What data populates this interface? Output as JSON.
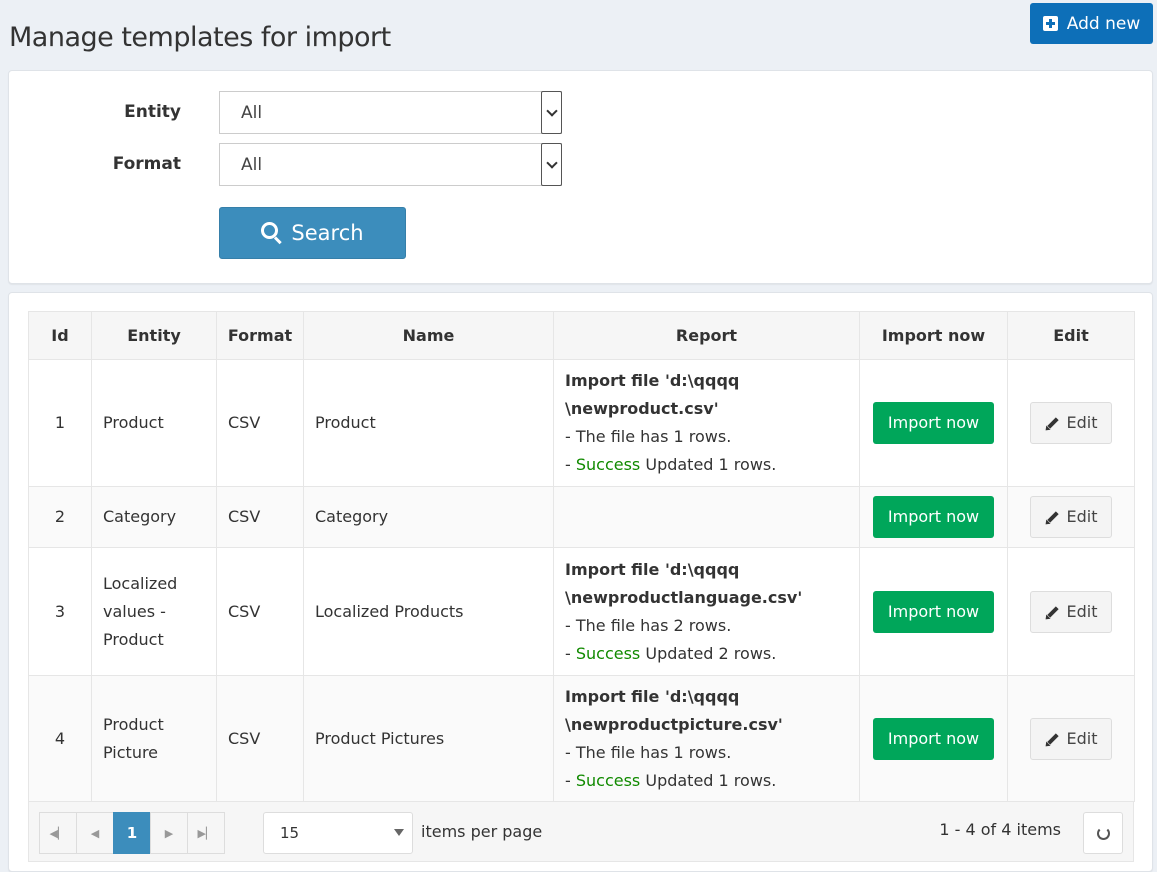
{
  "header": {
    "title": "Manage templates for import",
    "add_new_label": "Add new"
  },
  "filters": {
    "entity_label": "Entity",
    "entity_value": "All",
    "format_label": "Format",
    "format_value": "All",
    "search_label": "Search"
  },
  "table": {
    "columns": [
      "Id",
      "Entity",
      "Format",
      "Name",
      "Report",
      "Import now",
      "Edit"
    ],
    "rows": [
      {
        "id": "1",
        "entity": "Product",
        "format": "CSV",
        "name": "Product",
        "report": {
          "line1": "Import file 'd:\\qqqq",
          "line2": "\\newproduct.csv'",
          "line3": "- The file has 1 rows.",
          "prefix": "- ",
          "success": "Success",
          "suffix": " Updated 1 rows."
        },
        "import_label": "Import now",
        "edit_label": "Edit"
      },
      {
        "id": "2",
        "entity": "Category",
        "format": "CSV",
        "name": "Category",
        "report": null,
        "import_label": "Import now",
        "edit_label": "Edit"
      },
      {
        "id": "3",
        "entity_lines": [
          "Localized",
          "values -",
          "Product"
        ],
        "format": "CSV",
        "name": "Localized Products",
        "report": {
          "line1": "Import file 'd:\\qqqq",
          "line2": "\\newproductlanguage.csv'",
          "line3": "- The file has 2 rows.",
          "prefix": "- ",
          "success": "Success",
          "suffix": " Updated 2 rows."
        },
        "import_label": "Import now",
        "edit_label": "Edit"
      },
      {
        "id": "4",
        "entity_lines": [
          "Product",
          "Picture"
        ],
        "format": "CSV",
        "name": "Product Pictures",
        "report": {
          "line1": "Import file 'd:\\qqqq",
          "line2": "\\newproductpicture.csv'",
          "line3": "- The file has 1 rows.",
          "prefix": "- ",
          "success": "Success",
          "suffix": " Updated 1 rows."
        },
        "import_label": "Import now",
        "edit_label": "Edit"
      }
    ]
  },
  "pager": {
    "current_page": "1",
    "page_size": "15",
    "items_per_page_label": "items per page",
    "info": "1 - 4 of 4 items",
    "icons": [
      "first-page-icon",
      "prev-page-icon",
      "next-page-icon",
      "last-page-icon",
      "refresh-icon"
    ]
  },
  "colors": {
    "primary": "#3c8dbc",
    "add_new": "#0d6fb8",
    "success_button": "#00a65a",
    "success_text": "#118a00",
    "background": "#ecf0f5"
  }
}
